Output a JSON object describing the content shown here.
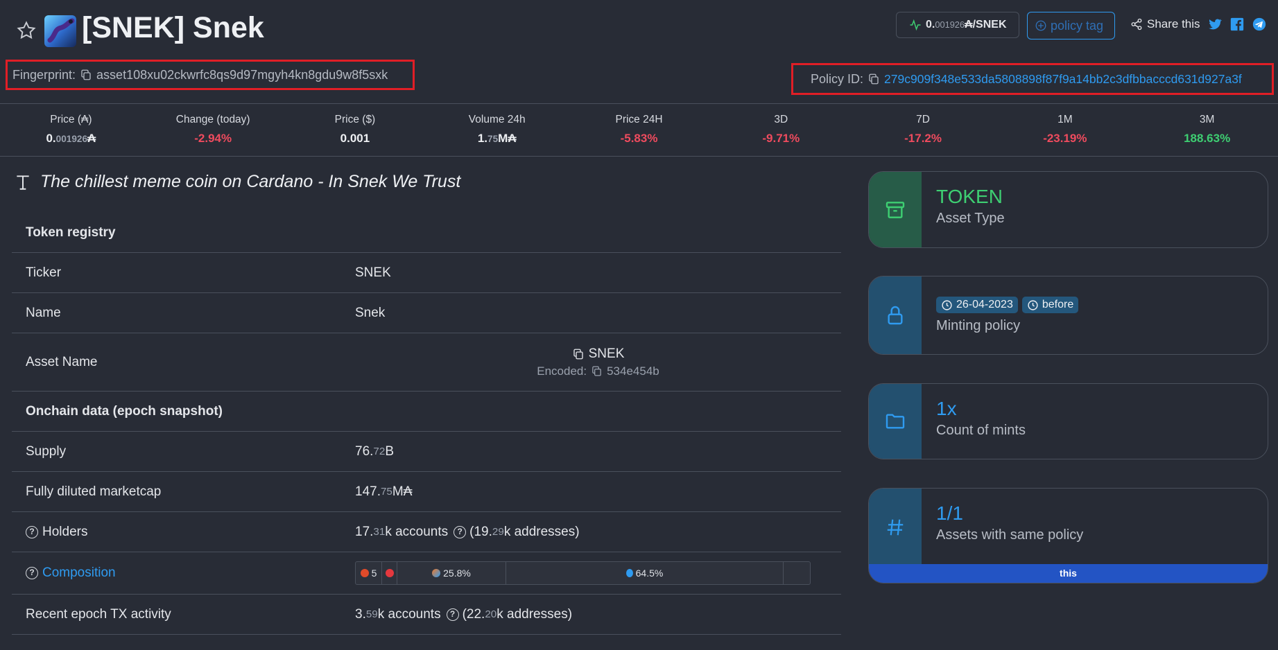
{
  "header": {
    "title": "[SNEK] Snek",
    "price_chip": {
      "price_main": "0.",
      "price_small": "001926",
      "unit": "₳/SNEK"
    },
    "policy_tag_label": "policy tag",
    "share_label": "Share this",
    "fingerprint_label": "Fingerprint:",
    "fingerprint": "asset108xu02ckwrfc8qs9d97mgyh4kn8gdu9w8f5sxk",
    "policy_id_label": "Policy ID:",
    "policy_id": "279c909f348e533da5808898f87f9a14bb2c3dfbbacccd631d927a3f"
  },
  "stats": [
    {
      "label": "Price (₳)",
      "value_main": "0.",
      "value_small": "001926",
      "value_suffix": "₳",
      "tone": "plain"
    },
    {
      "label": "Change (today)",
      "value_main": "-2.94%",
      "value_small": "",
      "value_suffix": "",
      "tone": "red"
    },
    {
      "label": "Price ($)",
      "value_main": "0.001",
      "value_small": "",
      "value_suffix": "",
      "tone": "plain"
    },
    {
      "label": "Volume 24h",
      "value_main": "1.",
      "value_small": "75",
      "value_suffix": "M₳",
      "tone": "plain"
    },
    {
      "label": "Price 24H",
      "value_main": "-5.83%",
      "value_small": "",
      "value_suffix": "",
      "tone": "red"
    },
    {
      "label": "3D",
      "value_main": "-9.71%",
      "value_small": "",
      "value_suffix": "",
      "tone": "red"
    },
    {
      "label": "7D",
      "value_main": "-17.2%",
      "value_small": "",
      "value_suffix": "",
      "tone": "red"
    },
    {
      "label": "1M",
      "value_main": "-23.19%",
      "value_small": "",
      "value_suffix": "",
      "tone": "red"
    },
    {
      "label": "3M",
      "value_main": "188.63%",
      "value_small": "",
      "value_suffix": "",
      "tone": "green"
    }
  ],
  "description": "The chillest meme coin on Cardano - In Snek We Trust",
  "table": {
    "token_registry_heading": "Token registry",
    "ticker_label": "Ticker",
    "ticker": "SNEK",
    "name_label": "Name",
    "name": "Snek",
    "asset_name_label": "Asset Name",
    "asset_name": "SNEK",
    "encoded_label": "Encoded:",
    "encoded": "534e454b",
    "onchain_heading": "Onchain data (epoch snapshot)",
    "supply_label": "Supply",
    "supply_main": "76.",
    "supply_small": "72",
    "supply_suffix": "B",
    "fdmc_label": "Fully diluted marketcap",
    "fdmc_main": "147.",
    "fdmc_small": "75",
    "fdmc_suffix": "M₳",
    "holders_label": "Holders",
    "holders_main": "17.",
    "holders_small": "31",
    "holders_suffix": "k accounts",
    "holders_addr_main": "(19.",
    "holders_addr_small": "29",
    "holders_addr_suffix": "k addresses)",
    "composition_label": "Composition",
    "composition": {
      "seg1_label": "5",
      "seg2_label": "25.8%",
      "seg3_label": "64.5%",
      "seg3_fraction": 0.645,
      "seg2_fraction": 0.258
    },
    "tx_label": "Recent epoch TX activity",
    "tx_main": "3.",
    "tx_small": "59",
    "tx_suffix": "k accounts",
    "tx_addr_main": "(22.",
    "tx_addr_small": "20",
    "tx_addr_suffix": "k addresses)"
  },
  "cards": {
    "asset_type": {
      "value": "TOKEN",
      "label": "Asset Type"
    },
    "minting": {
      "date": "26-04-2023",
      "before": "before",
      "label": "Minting policy"
    },
    "mints": {
      "value": "1x",
      "label": "Count of mints"
    },
    "same_policy": {
      "value": "1/1",
      "label": "Assets with same policy",
      "strip": "this"
    }
  },
  "colors": {
    "background": "#282c36",
    "accent_blue": "#2f9bf0",
    "red": "#ef4b5e",
    "green": "#3ecf72",
    "highlight_box": "#e01e26"
  }
}
